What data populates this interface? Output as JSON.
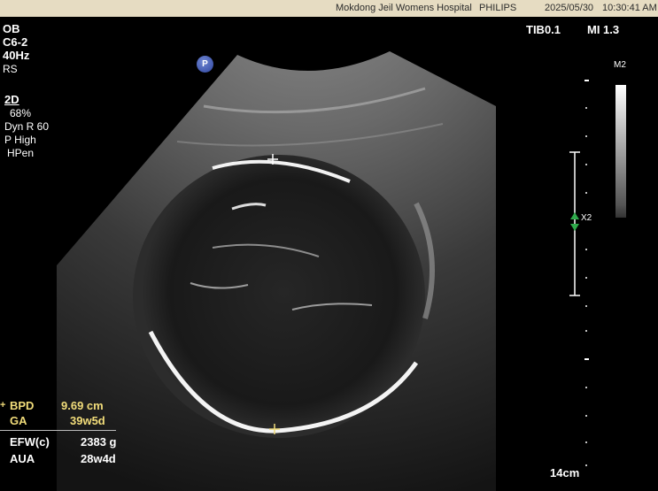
{
  "header": {
    "institution": "Mokdong Jeil Womens Hospital",
    "vendor": "PHILIPS",
    "date": "2025/05/30",
    "time": "10:30:41 AM"
  },
  "probe_info": {
    "preset": "OB",
    "probe": "C6-2",
    "frame_rate": "40Hz",
    "mode_rs": "RS",
    "mode_2d": "2D",
    "gain": "68%",
    "dyn_range": "Dyn R 60",
    "power": "P High",
    "harmonics": "HPen"
  },
  "indices": {
    "tib": "TIB0.1",
    "mi": "MI 1.3"
  },
  "grayscale": {
    "map": "M2"
  },
  "focus": {
    "zoom": "X2"
  },
  "depth": {
    "label": "14cm"
  },
  "badge": {
    "label": "P"
  },
  "measurements": {
    "bpd_marker": "+",
    "bpd_label": "BPD",
    "bpd_value": "9.69 cm",
    "ga_label": "GA",
    "ga_value": "39w5d",
    "efw_label": "EFW(c)",
    "efw_value": "2383 g",
    "aua_label": "AUA",
    "aua_value": "28w4d"
  },
  "colors": {
    "measurement_highlight": "#f1dc7a",
    "focus_arrow": "#2ea84a"
  }
}
